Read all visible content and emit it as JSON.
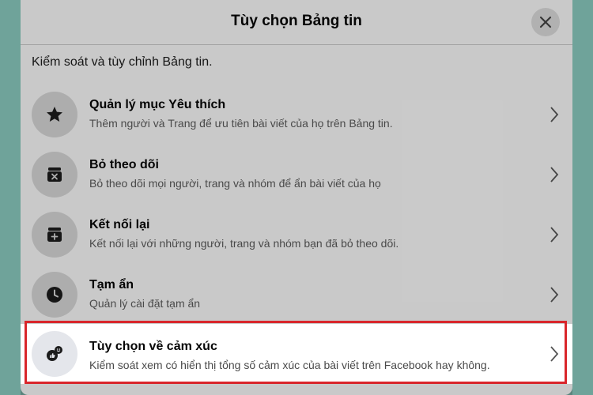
{
  "dialog": {
    "title": "Tùy chọn Bảng tin",
    "subtitle": "Kiểm soát và tùy chỉnh Bảng tin."
  },
  "items": [
    {
      "icon": "star-icon",
      "title": "Quản lý mục Yêu thích",
      "desc": "Thêm người và Trang để ưu tiên bài viết của họ trên Bảng tin."
    },
    {
      "icon": "unfollow-icon",
      "title": "Bỏ theo dõi",
      "desc": "Bỏ theo dõi mọi người, trang và nhóm để ẩn bài viết của họ"
    },
    {
      "icon": "reconnect-icon",
      "title": "Kết nối lại",
      "desc": "Kết nối lại với những người, trang và nhóm bạn đã bỏ theo dõi."
    },
    {
      "icon": "clock-icon",
      "title": "Tạm ẩn",
      "desc": "Quản lý cài đặt tạm ẩn"
    },
    {
      "icon": "reaction-icon",
      "title": "Tùy chọn về cảm xúc",
      "desc": "Kiểm soát xem có hiển thị tổng số cảm xúc của bài viết trên Facebook hay không."
    }
  ],
  "colors": {
    "highlight_border": "#d9262b",
    "background": "#6fa39a"
  }
}
